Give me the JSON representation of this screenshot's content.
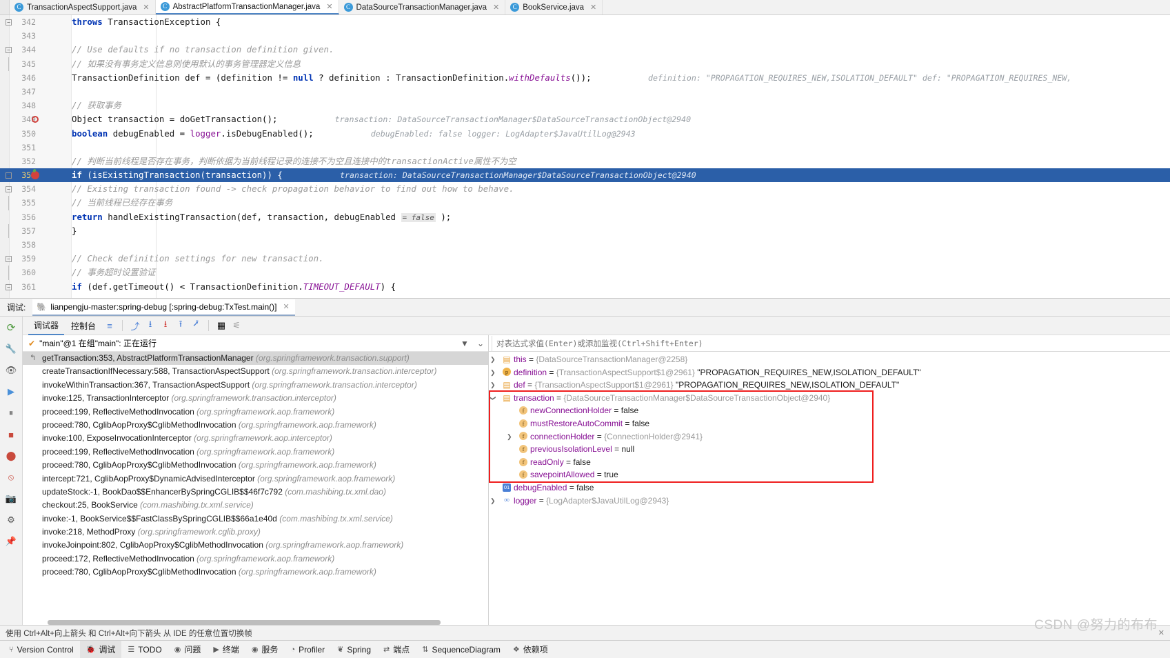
{
  "tabs": [
    {
      "label": "TransactionAspectSupport.java",
      "icon": "java-class-icon",
      "active": false
    },
    {
      "label": "AbstractPlatformTransactionManager.java",
      "icon": "java-class-icon",
      "active": true
    },
    {
      "label": "DataSourceTransactionManager.java",
      "icon": "java-class-icon",
      "active": false
    },
    {
      "label": "BookService.java",
      "icon": "java-class-icon",
      "active": false
    }
  ],
  "editor": {
    "lines": [
      {
        "num": "342",
        "marker": "",
        "fold": "minus",
        "code_html": "        <span class=\"kw\">throws</span> <span class=\"ident\">TransactionException</span> {",
        "hint": ""
      },
      {
        "num": "343",
        "marker": "",
        "fold": "",
        "code_html": "",
        "hint": ""
      },
      {
        "num": "344",
        "marker": "",
        "fold": "minus",
        "code_html": "        <span class=\"cmt\">// Use defaults if no transaction definition given.</span>",
        "hint": ""
      },
      {
        "num": "345",
        "marker": "",
        "fold": "bottom",
        "code_html": "        <span class=\"cmt\">// 如果没有事务定义信息则使用默认的事务管理器定义信息</span>",
        "hint": ""
      },
      {
        "num": "346",
        "marker": "",
        "fold": "",
        "code_html": "        <span class=\"ident\">TransactionDefinition</span> <span class=\"ident\">def</span> = (<span class=\"ident\">definition</span> != <span class=\"kw\">null</span> ? <span class=\"ident\">definition</span> : <span class=\"ident\">TransactionDefinition</span>.<span class=\"stat\">withDefaults</span>());",
        "hint": "definition:  \"PROPAGATION_REQUIRES_NEW,ISOLATION_DEFAULT\"      def:  \"PROPAGATION_REQUIRES_NEW,"
      },
      {
        "num": "347",
        "marker": "",
        "fold": "",
        "code_html": "",
        "hint": ""
      },
      {
        "num": "348",
        "marker": "",
        "fold": "",
        "code_html": "        <span class=\"cmt\">// 获取事务</span>",
        "hint": ""
      },
      {
        "num": "349",
        "marker": "breakpoint-ring",
        "fold": "",
        "code_html": "        <span class=\"ident\">Object</span> <span class=\"ident\">transaction</span> = <span class=\"meth\">doGetTransaction</span>();",
        "hint": "transaction:  DataSourceTransactionManager$DataSourceTransactionObject@2940"
      },
      {
        "num": "350",
        "marker": "",
        "fold": "",
        "code_html": "        <span class=\"kw\">boolean</span> <span class=\"ident\">debugEnabled</span> = <span class=\"field\">logger</span>.<span class=\"meth\">isDebugEnabled</span>();",
        "hint": "debugEnabled:  false        logger:  LogAdapter$JavaUtilLog@2943"
      },
      {
        "num": "351",
        "marker": "",
        "fold": "",
        "code_html": "",
        "hint": ""
      },
      {
        "num": "352",
        "marker": "",
        "fold": "",
        "code_html": "        <span class=\"cmt\">// 判断当前线程是否存在事务，判断依据为当前线程记录的连接不为空且连接中的transactionActive属性不为空</span>",
        "hint": ""
      },
      {
        "num": "353",
        "marker": "breakpoint-hit",
        "fold": "minus",
        "highlight": true,
        "code_html": "        <span class=\"kw\">if</span> (<span class=\"meth\">isExistingTransaction</span>(<span class=\"ident\">transaction</span>)) {",
        "hint": "transaction:  DataSourceTransactionManager$DataSourceTransactionObject@2940"
      },
      {
        "num": "354",
        "marker": "",
        "fold": "minus",
        "code_html": "            <span class=\"cmt\">// Existing transaction found -&gt; check propagation behavior to find out how to behave.</span>",
        "hint": ""
      },
      {
        "num": "355",
        "marker": "",
        "fold": "bottom",
        "code_html": "            <span class=\"cmt\">// 当前线程已经存在事务</span>",
        "hint": ""
      },
      {
        "num": "356",
        "marker": "",
        "fold": "",
        "code_html": "            <span class=\"kw\">return</span> <span class=\"meth\">handleExistingTransaction</span>(<span class=\"ident\">def</span>, <span class=\"ident\">transaction</span>, <span class=\"ident\">debugEnabled</span> <span class=\"inlval\">= false</span> );",
        "hint": ""
      },
      {
        "num": "357",
        "marker": "",
        "fold": "bottom",
        "code_html": "        }",
        "hint": ""
      },
      {
        "num": "358",
        "marker": "",
        "fold": "",
        "code_html": "",
        "hint": ""
      },
      {
        "num": "359",
        "marker": "",
        "fold": "minus",
        "code_html": "        <span class=\"cmt\">// Check definition settings for new transaction.</span>",
        "hint": ""
      },
      {
        "num": "360",
        "marker": "",
        "fold": "bottom",
        "code_html": "        <span class=\"cmt\">// 事务超时设置验证</span>",
        "hint": ""
      },
      {
        "num": "361",
        "marker": "",
        "fold": "minus",
        "code_html": "        <span class=\"kw\">if</span> (<span class=\"ident\">def</span>.<span class=\"meth\">getTimeout</span>() &lt; <span class=\"ident\">TransactionDefinition</span>.<span class=\"stat\">TIMEOUT_DEFAULT</span>) {",
        "hint": ""
      }
    ]
  },
  "debug_header": {
    "label": "调试:",
    "config_name": "lianpengju-master:spring-debug [:spring-debug:TxTest.main()]",
    "close_icon": "close-icon",
    "run_icon": "gradle-elephant-icon"
  },
  "debug_toolbar": {
    "tabs": [
      {
        "label": "调试器",
        "active": true
      },
      {
        "label": "控制台",
        "active": false
      }
    ],
    "icons": [
      {
        "name": "layout-icon",
        "glyph": "≡"
      },
      {
        "name": "step-over-icon",
        "glyph": "⤴"
      },
      {
        "name": "step-into-icon",
        "glyph": "⭳"
      },
      {
        "name": "force-step-into-icon",
        "glyph": "⭳"
      },
      {
        "name": "step-out-icon",
        "glyph": "⭱"
      },
      {
        "name": "run-to-cursor-icon",
        "glyph": "⭷"
      },
      {
        "name": "evaluate-expression-icon",
        "glyph": "▦"
      },
      {
        "name": "settings-icon",
        "glyph": "⚟"
      }
    ]
  },
  "debug_sidebar": {
    "icons": [
      {
        "name": "rerun-icon",
        "glyph": "⟳"
      },
      {
        "name": "wrench-icon",
        "glyph": "🔧"
      },
      {
        "name": "eye-icon",
        "glyph": "👁"
      },
      {
        "name": "resume-program-icon",
        "glyph": "▶"
      },
      {
        "name": "pause-program-icon",
        "glyph": "⏸"
      },
      {
        "name": "stop-icon",
        "glyph": "■"
      },
      {
        "name": "view-breakpoints-icon",
        "glyph": "⬤"
      },
      {
        "name": "mute-breakpoints-icon",
        "glyph": "⦸"
      },
      {
        "name": "screenshot-icon",
        "glyph": "📷"
      },
      {
        "name": "settings-gear-icon",
        "glyph": "⚙"
      },
      {
        "name": "pin-icon",
        "glyph": "📌"
      }
    ]
  },
  "frames": {
    "thread_status": "\"main\"@1 在组\"main\": 正在运行",
    "thread_check_icon": "checkmark-icon",
    "filter_icon": "filter-icon",
    "dropdown_icon": "chevron-down-icon",
    "rows": [
      {
        "text": "getTransaction:353, AbstractPlatformTransactionManager",
        "pkg": "(org.springframework.transaction.support)",
        "selected": true,
        "has_return_icon": true
      },
      {
        "text": "createTransactionIfNecessary:588, TransactionAspectSupport",
        "pkg": "(org.springframework.transaction.interceptor)",
        "selected": false,
        "has_return_icon": false
      },
      {
        "text": "invokeWithinTransaction:367, TransactionAspectSupport",
        "pkg": "(org.springframework.transaction.interceptor)",
        "selected": false,
        "has_return_icon": false
      },
      {
        "text": "invoke:125, TransactionInterceptor",
        "pkg": "(org.springframework.transaction.interceptor)",
        "selected": false,
        "has_return_icon": false
      },
      {
        "text": "proceed:199, ReflectiveMethodInvocation",
        "pkg": "(org.springframework.aop.framework)",
        "selected": false,
        "has_return_icon": false
      },
      {
        "text": "proceed:780, CglibAopProxy$CglibMethodInvocation",
        "pkg": "(org.springframework.aop.framework)",
        "selected": false,
        "has_return_icon": false
      },
      {
        "text": "invoke:100, ExposeInvocationInterceptor",
        "pkg": "(org.springframework.aop.interceptor)",
        "selected": false,
        "has_return_icon": false
      },
      {
        "text": "proceed:199, ReflectiveMethodInvocation",
        "pkg": "(org.springframework.aop.framework)",
        "selected": false,
        "has_return_icon": false
      },
      {
        "text": "proceed:780, CglibAopProxy$CglibMethodInvocation",
        "pkg": "(org.springframework.aop.framework)",
        "selected": false,
        "has_return_icon": false
      },
      {
        "text": "intercept:721, CglibAopProxy$DynamicAdvisedInterceptor",
        "pkg": "(org.springframework.aop.framework)",
        "selected": false,
        "has_return_icon": false
      },
      {
        "text": "updateStock:-1, BookDao$$EnhancerBySpringCGLIB$$46f7c792",
        "pkg": "(com.mashibing.tx.xml.dao)",
        "selected": false,
        "has_return_icon": false
      },
      {
        "text": "checkout:25, BookService",
        "pkg": "(com.mashibing.tx.xml.service)",
        "selected": false,
        "has_return_icon": false
      },
      {
        "text": "invoke:-1, BookService$$FastClassBySpringCGLIB$$66a1e40d",
        "pkg": "(com.mashibing.tx.xml.service)",
        "selected": false,
        "has_return_icon": false
      },
      {
        "text": "invoke:218, MethodProxy",
        "pkg": "(org.springframework.cglib.proxy)",
        "selected": false,
        "has_return_icon": false
      },
      {
        "text": "invokeJoinpoint:802, CglibAopProxy$CglibMethodInvocation",
        "pkg": "(org.springframework.aop.framework)",
        "selected": false,
        "has_return_icon": false
      },
      {
        "text": "proceed:172, ReflectiveMethodInvocation",
        "pkg": "(org.springframework.aop.framework)",
        "selected": false,
        "has_return_icon": false
      },
      {
        "text": "proceed:780, CglibAopProxy$CglibMethodInvocation",
        "pkg": "(org.springframework.aop.framework)",
        "selected": false,
        "has_return_icon": false
      }
    ]
  },
  "variables": {
    "watch_placeholder": "对表达式求值(Enter)或添加监视(Ctrl+Shift+Enter)",
    "rows": [
      {
        "indent": 0,
        "arrow": "collapsed",
        "icon": "obj",
        "icon_letter": "▤",
        "name": "this",
        "eq": " = ",
        "ref": "{DataSourceTransactionManager@2258}",
        "str": "",
        "boxed": false
      },
      {
        "indent": 0,
        "arrow": "collapsed",
        "icon": "p",
        "icon_letter": "p",
        "name": "definition",
        "eq": " = ",
        "ref": "{TransactionAspectSupport$1@2961}",
        "str": "\"PROPAGATION_REQUIRES_NEW,ISOLATION_DEFAULT\"",
        "boxed": false
      },
      {
        "indent": 0,
        "arrow": "collapsed",
        "icon": "obj",
        "icon_letter": "▤",
        "name": "def",
        "eq": " = ",
        "ref": "{TransactionAspectSupport$1@2961}",
        "str": "\"PROPAGATION_REQUIRES_NEW,ISOLATION_DEFAULT\"",
        "boxed": false
      },
      {
        "indent": 0,
        "arrow": "expanded",
        "icon": "obj",
        "icon_letter": "▤",
        "name": "transaction",
        "eq": " = ",
        "ref": "{DataSourceTransactionManager$DataSourceTransactionObject@2940}",
        "str": "",
        "boxed": true
      },
      {
        "indent": 1,
        "arrow": "none",
        "icon": "f",
        "icon_letter": "f",
        "name": "newConnectionHolder",
        "eq": " = ",
        "ref": "",
        "str": "false",
        "boxed": true
      },
      {
        "indent": 1,
        "arrow": "none",
        "icon": "f",
        "icon_letter": "f",
        "name": "mustRestoreAutoCommit",
        "eq": " = ",
        "ref": "",
        "str": "false",
        "boxed": true
      },
      {
        "indent": 1,
        "arrow": "collapsed",
        "icon": "f",
        "icon_letter": "f",
        "name": "connectionHolder",
        "eq": " = ",
        "ref": "{ConnectionHolder@2941}",
        "str": "",
        "boxed": true
      },
      {
        "indent": 1,
        "arrow": "none",
        "icon": "f",
        "icon_letter": "f",
        "name": "previousIsolationLevel",
        "eq": " = ",
        "ref": "",
        "str": "null",
        "boxed": true
      },
      {
        "indent": 1,
        "arrow": "none",
        "icon": "f",
        "icon_letter": "f",
        "name": "readOnly",
        "eq": " = ",
        "ref": "",
        "str": "false",
        "boxed": true
      },
      {
        "indent": 1,
        "arrow": "none",
        "icon": "f",
        "icon_letter": "f",
        "name": "savepointAllowed",
        "eq": " = ",
        "ref": "",
        "str": "true",
        "boxed": true
      },
      {
        "indent": 0,
        "arrow": "none",
        "icon": "num",
        "icon_letter": "01",
        "name": "debugEnabled",
        "eq": " = ",
        "ref": "",
        "str": "false",
        "boxed": false
      },
      {
        "indent": 0,
        "arrow": "collapsed",
        "icon": "oo",
        "icon_letter": "∞",
        "name": "logger",
        "eq": " = ",
        "ref": "{LogAdapter$JavaUtilLog@2943}",
        "str": "",
        "boxed": false
      }
    ]
  },
  "tip": {
    "text": "使用 Ctrl+Alt+向上箭头 和 Ctrl+Alt+向下箭头 从 IDE 的任意位置切换帧",
    "close_icon": "close-icon"
  },
  "watermark": "CSDN @努力的布布",
  "statusbar": {
    "items": [
      {
        "label": "Version Control",
        "icon": "branch-icon",
        "active": false
      },
      {
        "label": "调试",
        "icon": "debug-bug-icon",
        "active": true
      },
      {
        "label": "TODO",
        "icon": "todo-icon",
        "active": false
      },
      {
        "label": "问题",
        "icon": "problems-icon",
        "active": false
      },
      {
        "label": "终端",
        "icon": "terminal-icon",
        "active": false
      },
      {
        "label": "服务",
        "icon": "services-icon",
        "active": false
      },
      {
        "label": "Profiler",
        "icon": "profiler-icon",
        "active": false
      },
      {
        "label": "Spring",
        "icon": "spring-leaf-icon",
        "active": false
      },
      {
        "label": "端点",
        "icon": "endpoints-icon",
        "active": false
      },
      {
        "label": "SequenceDiagram",
        "icon": "sequence-diagram-icon",
        "active": false
      },
      {
        "label": "依赖项",
        "icon": "dependencies-icon",
        "active": false
      }
    ]
  },
  "colors": {
    "accent": "#4f86c6",
    "highlight_line": "#2b5fa8",
    "breakpoint": "#d2423d",
    "redbox": "#ef1e1e",
    "purple_name": "#871094"
  }
}
